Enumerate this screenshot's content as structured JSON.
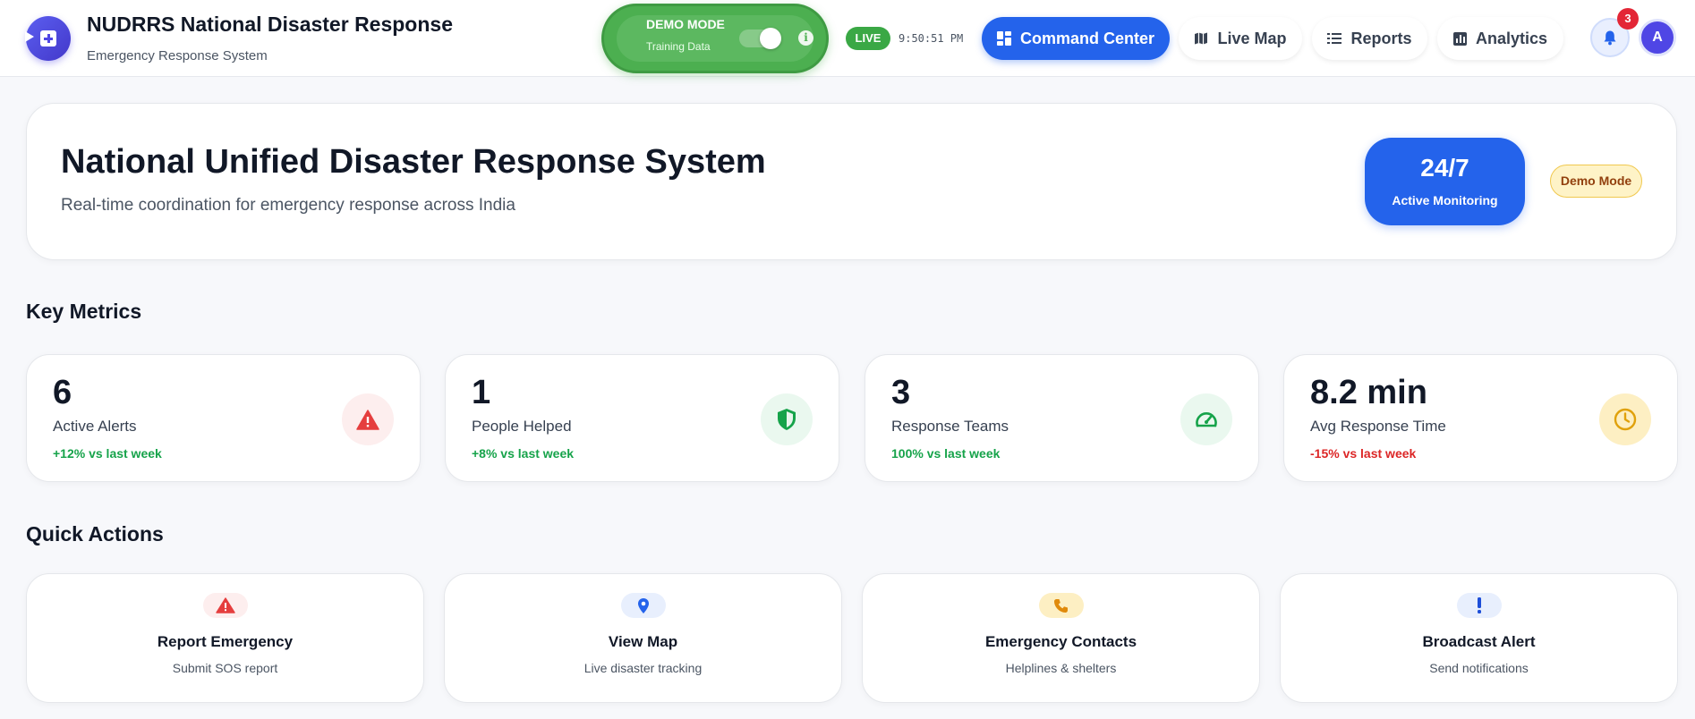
{
  "colors": {
    "primary": "#2463eb",
    "demo_green": "#4caf50",
    "live_green": "#3aa845",
    "positive": "#16a34a",
    "negative": "#dc2626",
    "notification": "#e32636",
    "warning_badge": "#fef3c7"
  },
  "header": {
    "title": "NUDRRS National Disaster Response",
    "subtitle": "Emergency Response System",
    "logo_icon": "medical-plus-icon",
    "demo_mode": {
      "title": "DEMO MODE",
      "subtitle": "Training Data",
      "enabled": true
    },
    "live_label": "LIVE",
    "clock": "9:50:51 PM",
    "nav": [
      {
        "label": "Command Center",
        "icon": "dashboard-grid-icon",
        "active": true
      },
      {
        "label": "Live Map",
        "icon": "map-icon",
        "active": false
      },
      {
        "label": "Reports",
        "icon": "list-icon",
        "active": false
      },
      {
        "label": "Analytics",
        "icon": "bar-chart-icon",
        "active": false
      }
    ],
    "notifications_count": "3",
    "avatar_initial": "A"
  },
  "hero": {
    "title": "National Unified Disaster Response System",
    "subtitle": "Real-time coordination for emergency response across India",
    "monitoring_value": "24/7",
    "monitoring_label": "Active Monitoring",
    "badge": "Demo Mode"
  },
  "metrics": {
    "section_title": "Key Metrics",
    "items": [
      {
        "value": "6",
        "label": "Active Alerts",
        "change": "+12% vs last week",
        "trend": "positive",
        "icon": "warning-triangle-icon"
      },
      {
        "value": "1",
        "label": "People Helped",
        "change": "+8% vs last week",
        "trend": "positive",
        "icon": "shield-icon"
      },
      {
        "value": "3",
        "label": "Response Teams",
        "change": "100% vs last week",
        "trend": "positive",
        "icon": "speedometer-icon"
      },
      {
        "value": "8.2 min",
        "label": "Avg Response Time",
        "change": "-15% vs last week",
        "trend": "negative",
        "icon": "clock-icon"
      }
    ]
  },
  "quick_actions": {
    "section_title": "Quick Actions",
    "items": [
      {
        "title": "Report Emergency",
        "subtitle": "Submit SOS report",
        "icon": "warning-triangle-icon"
      },
      {
        "title": "View Map",
        "subtitle": "Live disaster tracking",
        "icon": "map-pin-icon"
      },
      {
        "title": "Emergency Contacts",
        "subtitle": "Helplines & shelters",
        "icon": "phone-icon"
      },
      {
        "title": "Broadcast Alert",
        "subtitle": "Send notifications",
        "icon": "exclamation-icon"
      }
    ]
  }
}
